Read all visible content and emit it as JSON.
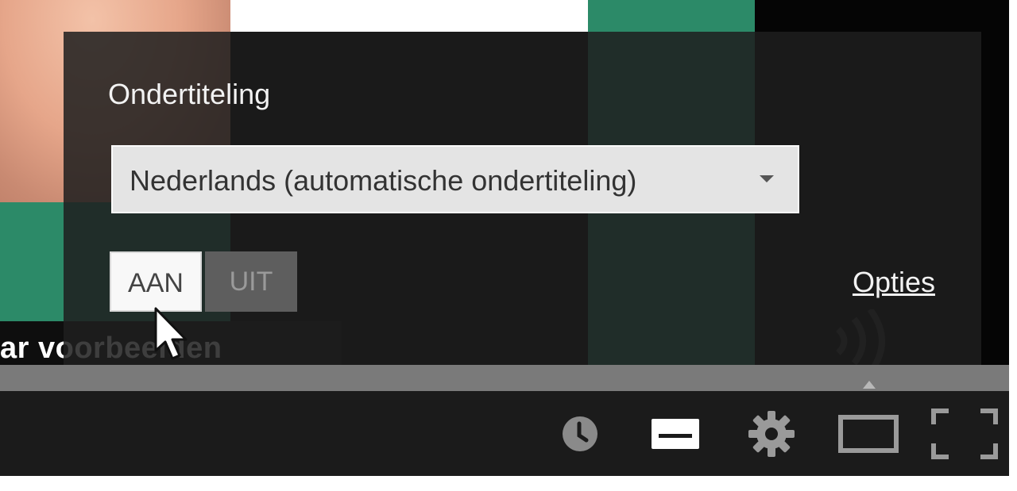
{
  "captions_menu": {
    "title": "Ondertiteling",
    "language_select": {
      "selected": "Nederlands (automatische ondertiteling)"
    },
    "toggle": {
      "on_label": "AAN",
      "off_label": "UIT",
      "state": "on"
    },
    "options_link": "Opties"
  },
  "video": {
    "caption_text": "ar voorbeelden"
  },
  "player_controls": {
    "icons": [
      "watch-later-icon",
      "captions-icon",
      "settings-icon",
      "theater-mode-icon",
      "fullscreen-icon"
    ]
  },
  "colors": {
    "popup_background": "#1e1e1e",
    "select_background": "#e4e4e4",
    "toggle_on": "#f8f8f8",
    "toggle_off": "#5e5e5e",
    "progress": "#7a7a7a",
    "control_bar": "#1b1b1b"
  }
}
